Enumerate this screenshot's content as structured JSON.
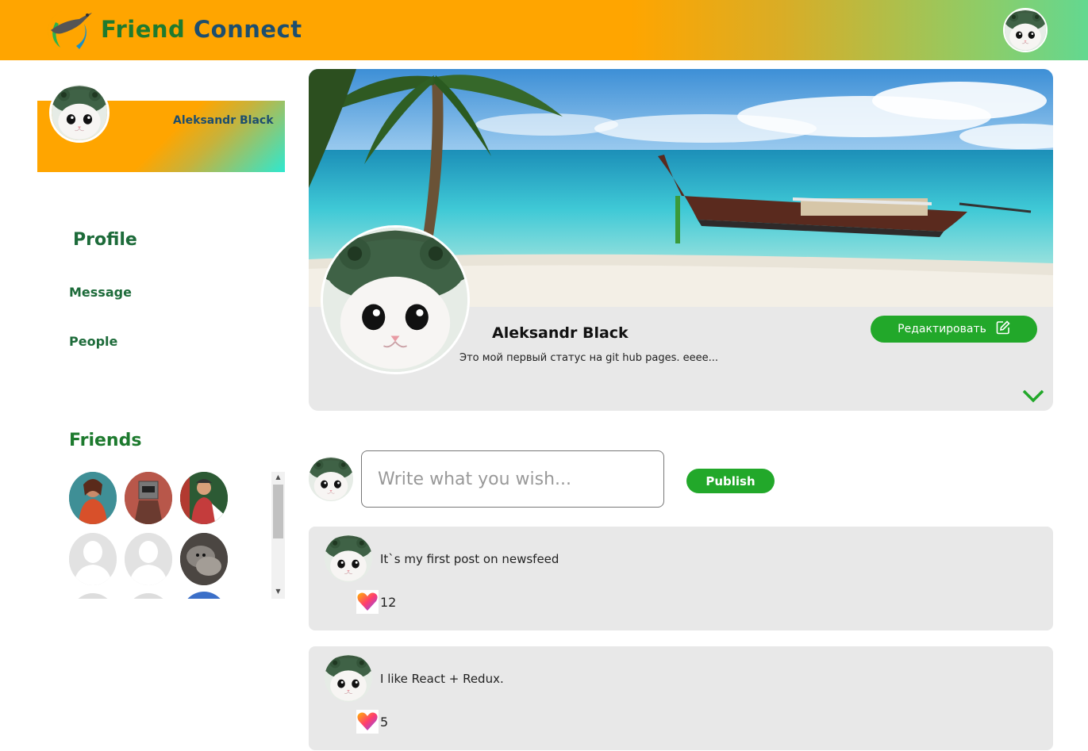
{
  "header": {
    "brand_part1": "Friend",
    "brand_part2": "Connect",
    "logo_icon": "bird-globe-logo",
    "user_avatar_icon": "cat-avatar"
  },
  "sidebar": {
    "user_name": "Aleksandr Black",
    "nav": {
      "profile": "Profile",
      "message": "Message",
      "people": "People"
    },
    "friends_title": "Friends"
  },
  "profile": {
    "name": "Aleksandr Black",
    "status": "Это мой первый статус на git hub pages. eeee...",
    "edit_label": "Редактировать",
    "cover_image": "tropical-beach-with-longtail-boat"
  },
  "new_post": {
    "placeholder": "Write what you wish...",
    "publish_label": "Publish"
  },
  "posts": [
    {
      "text": "It`s my first post on newsfeed",
      "likes": "12"
    },
    {
      "text": "I like React + Redux.",
      "likes": "5"
    }
  ],
  "colors": {
    "header_orange": "#ffa500",
    "accent_green": "#22a82a",
    "text_green": "#1d6b3a",
    "panel_gray": "#e8e8e8"
  }
}
